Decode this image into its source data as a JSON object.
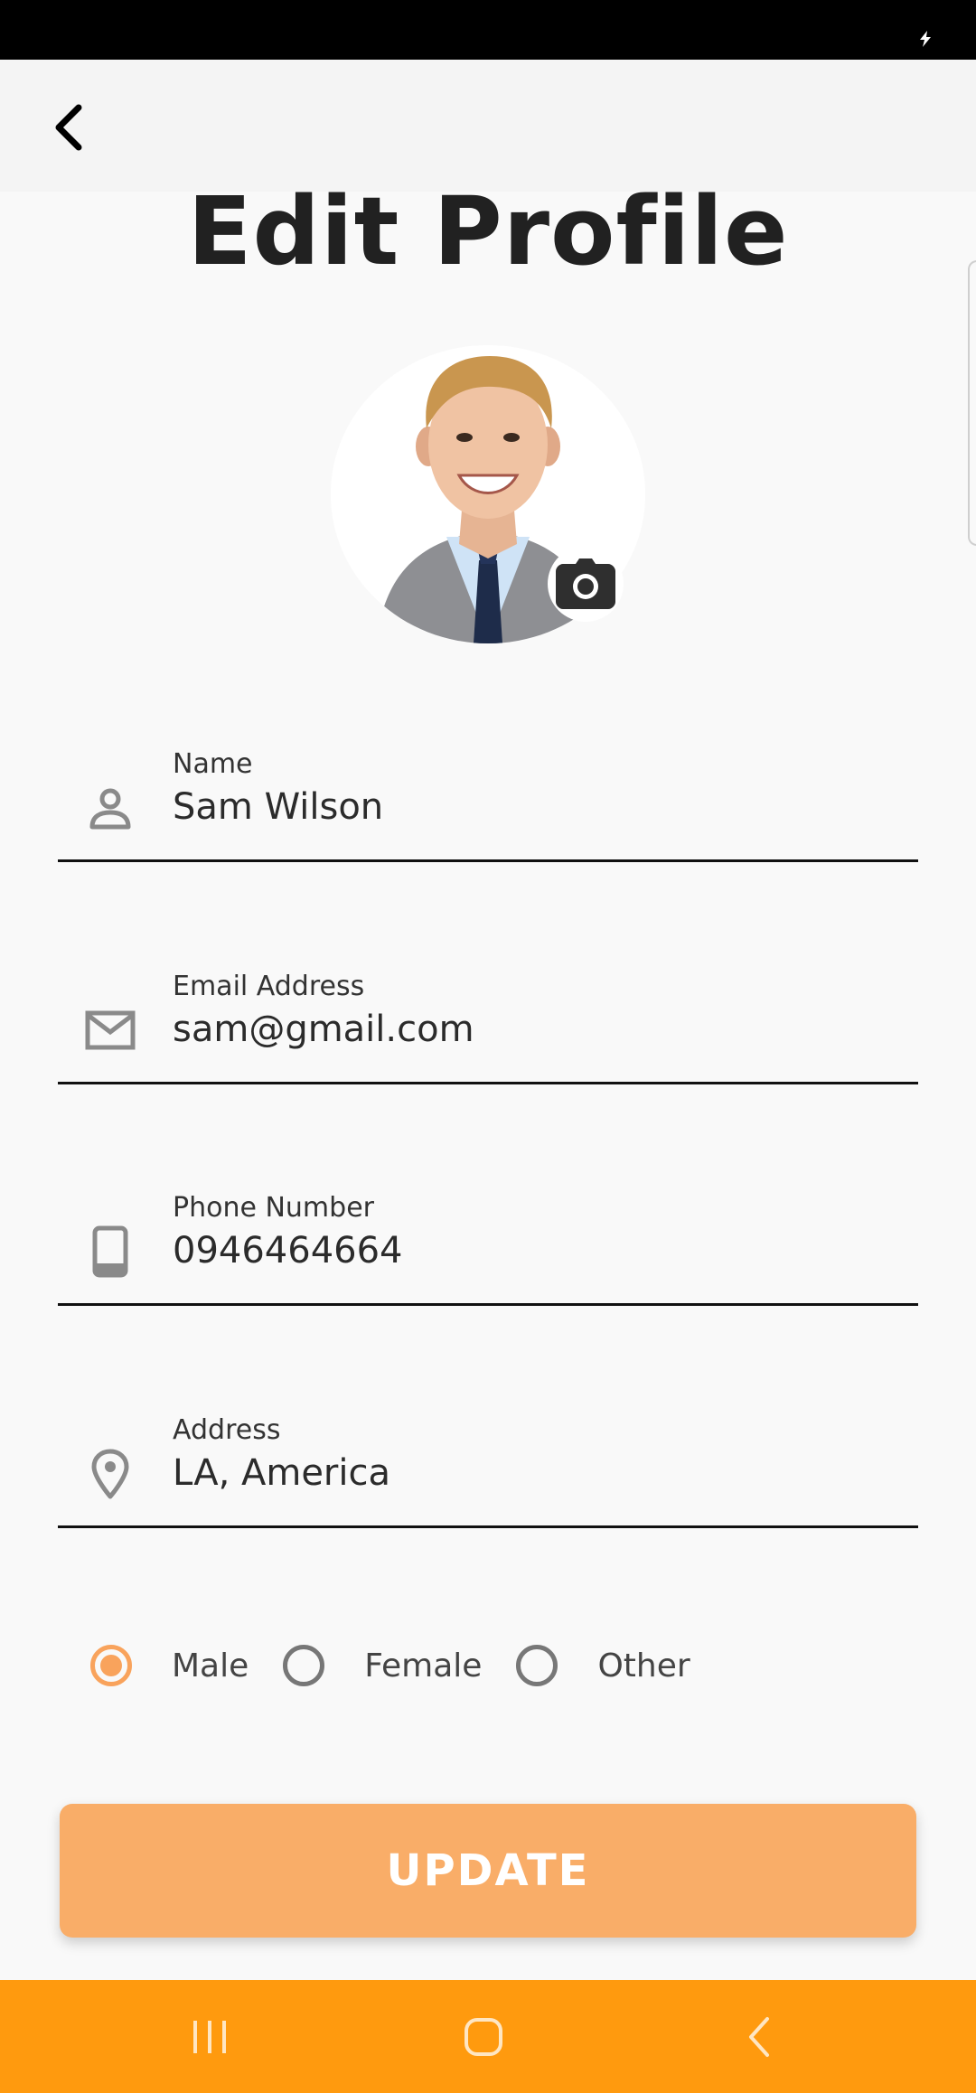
{
  "header": {
    "back_icon": "chevron-left-icon"
  },
  "page": {
    "title": "Edit Profile"
  },
  "profile": {
    "avatar_icon": "person-photo",
    "camera_icon": "camera-icon"
  },
  "fields": [
    {
      "icon": "person-icon",
      "label": "Name",
      "value": "Sam Wilson"
    },
    {
      "icon": "mail-icon",
      "label": "Email Address",
      "value": "sam@gmail.com"
    },
    {
      "icon": "phone-icon",
      "label": "Phone Number",
      "value": "0946464664"
    },
    {
      "icon": "location-pin-icon",
      "label": "Address",
      "value": "LA, America"
    }
  ],
  "gender": {
    "options": [
      "Male",
      "Female",
      "Other"
    ],
    "selected": "Male"
  },
  "actions": {
    "update_label": "UPDATE"
  },
  "colors": {
    "accent": "#f9a35c",
    "button": "#f9ad68",
    "nav_bar": "#ff9a0e",
    "status_bar": "#000000"
  }
}
